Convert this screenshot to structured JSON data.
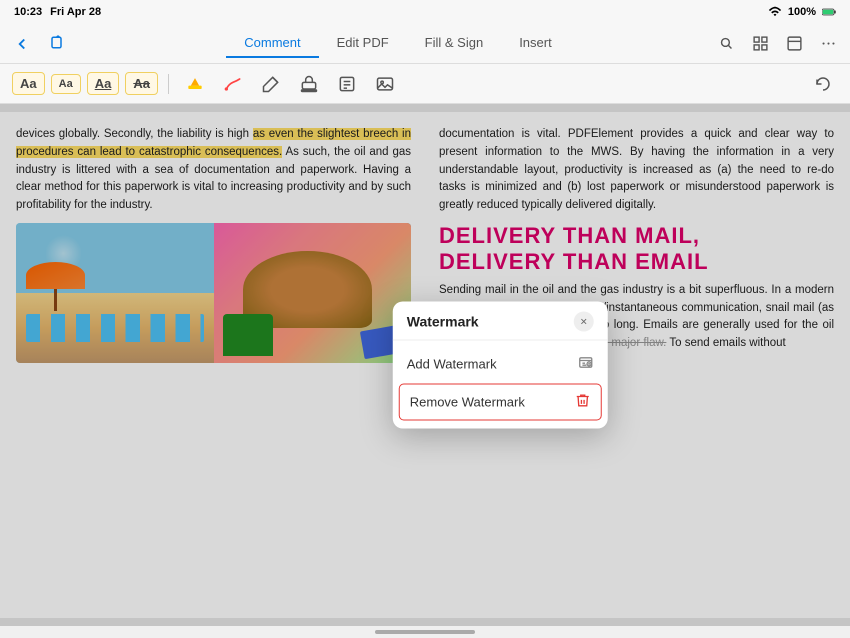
{
  "statusBar": {
    "time": "10:23",
    "day": "Fri Apr 28",
    "battery": "100%",
    "batteryIcon": "battery-full-icon",
    "wifiIcon": "wifi-icon",
    "signalIcon": "signal-icon"
  },
  "navBar": {
    "backIcon": "back-icon",
    "shareIcon": "share-icon",
    "dotsIcon": "more-icon",
    "tabs": [
      {
        "label": "Comment",
        "active": true
      },
      {
        "label": "Edit PDF",
        "active": false
      },
      {
        "label": "Fill & Sign",
        "active": false
      },
      {
        "label": "Insert",
        "active": false
      }
    ],
    "rightIcons": [
      "search-icon",
      "grid-icon",
      "layout-icon",
      "more-icon"
    ]
  },
  "toolbar": {
    "textButtons": [
      {
        "label": "Aa",
        "style": "normal"
      },
      {
        "label": "Aa",
        "style": "normal"
      },
      {
        "label": "Aa",
        "style": "underline"
      },
      {
        "label": "Aa",
        "style": "strikethrough"
      }
    ],
    "icons": [
      "highlight-icon",
      "underline-icon",
      "pencil-icon",
      "stamp-icon",
      "note-icon",
      "image-icon"
    ],
    "undoIcon": "undo-icon"
  },
  "pdf": {
    "leftColumn": {
      "paragraphs": [
        "devices globally. Secondly, the liability is high as even the slightest breech in procedures can lead to catastrophic consequences. As such, the oil and gas industry is littered with a sea of documentation and paperwork. Having a clear method for this paperwork is vital to increasing productivity and by such profitability for the industry."
      ]
    },
    "rightColumn": {
      "paragraphs": [
        "documentation is vital. PDFElement provides a quick and clear way to present information to the MWS. By having the information in a very understandable layout, productivity is increased as (a) the need to re-do tasks is minimized and (b) lost paperwork or misunderstood paperwork is greatly reduced typically delivered digitally.",
        "Sending mail in the oil and the gas industry is a bit superfluous. In a modern world of digital media and mass/instantaneous communication, snail mail (as it is commonly referred) takes to long. Emails are generally used for the oil and gas industry, but there is one major flaw. To send emails without"
      ],
      "watermarkLines": [
        "DELIVERY THAN MAIL,",
        "DELIVERY THAN EMAIL"
      ]
    }
  },
  "modal": {
    "title": "Watermark",
    "closeLabel": "×",
    "items": [
      {
        "label": "Add Watermark",
        "icon": "add-watermark-icon",
        "selected": false
      },
      {
        "label": "Remove Watermark",
        "icon": "delete-icon",
        "selected": true
      }
    ]
  },
  "bottomBar": {
    "homeIndicator": true
  }
}
